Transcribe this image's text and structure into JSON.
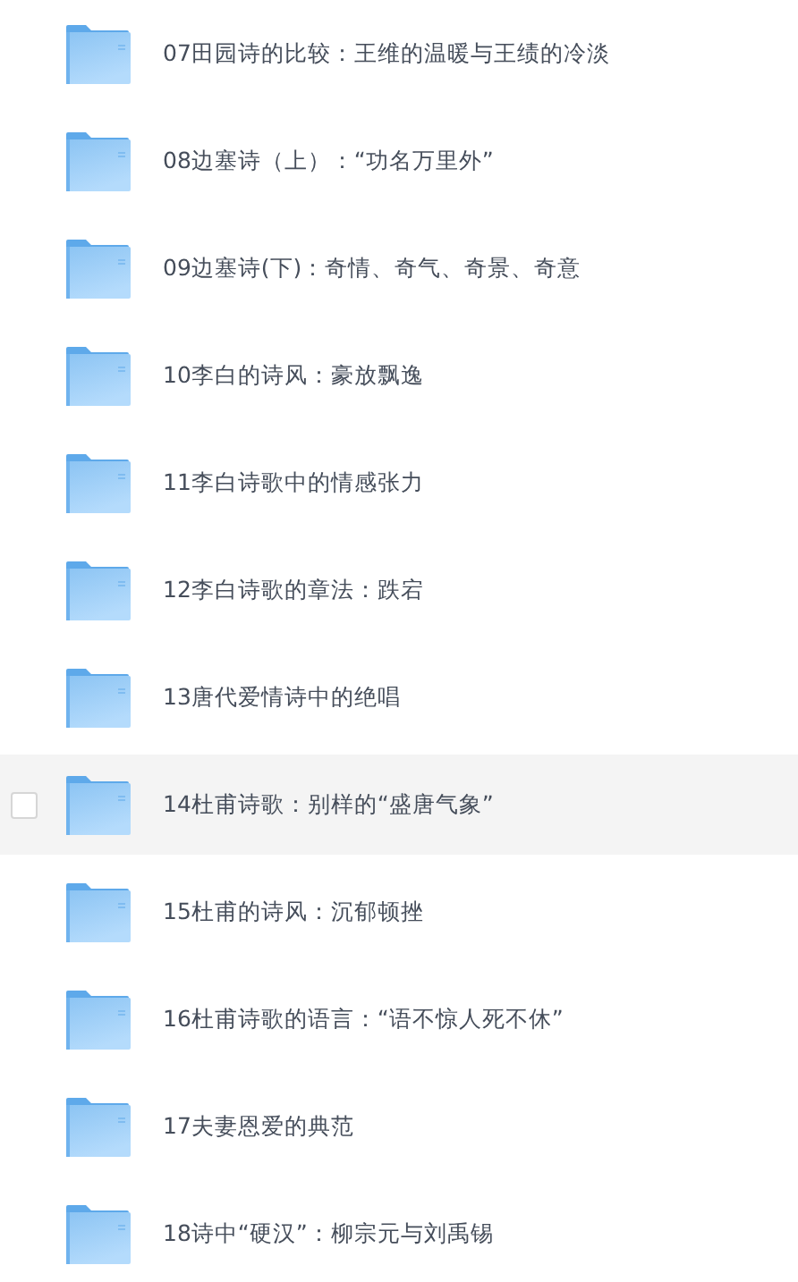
{
  "folders": [
    {
      "name": "07田园诗的比较：王维的温暖与王绩的冷淡",
      "highlighted": false,
      "checked": false
    },
    {
      "name": "08边塞诗（上）：“功名万里外”",
      "highlighted": false,
      "checked": false
    },
    {
      "name": "09边塞诗(下)：奇情、奇气、奇景、奇意",
      "highlighted": false,
      "checked": false
    },
    {
      "name": "10李白的诗风：豪放飘逸",
      "highlighted": false,
      "checked": false
    },
    {
      "name": "11李白诗歌中的情感张力",
      "highlighted": false,
      "checked": false
    },
    {
      "name": "12李白诗歌的章法：跌宕",
      "highlighted": false,
      "checked": false
    },
    {
      "name": "13唐代爱情诗中的绝唱",
      "highlighted": false,
      "checked": false
    },
    {
      "name": "14杜甫诗歌：别样的“盛唐气象”",
      "highlighted": true,
      "checked": false
    },
    {
      "name": "15杜甫的诗风：沉郁顿挫",
      "highlighted": false,
      "checked": false
    },
    {
      "name": "16杜甫诗歌的语言：“语不惊人死不休”",
      "highlighted": false,
      "checked": false
    },
    {
      "name": "17夫妻恩爱的典范",
      "highlighted": false,
      "checked": false
    },
    {
      "name": "18诗中“硬汉”：柳宗元与刘禹锡",
      "highlighted": false,
      "checked": false
    }
  ]
}
